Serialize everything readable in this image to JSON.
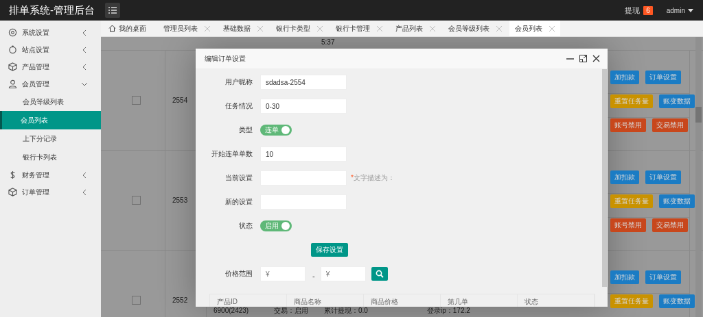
{
  "header": {
    "title": "排单系统-管理后台",
    "withdraw_label": "提现",
    "withdraw_count": "6",
    "user": "admin"
  },
  "sidebar": {
    "items": [
      {
        "label": "系统设置",
        "expanded": false
      },
      {
        "label": "站点设置",
        "expanded": false
      },
      {
        "label": "产品管理",
        "expanded": false
      },
      {
        "label": "会员管理",
        "expanded": true,
        "children": [
          {
            "label": "会员等级列表",
            "selected": false
          },
          {
            "label": "会员列表",
            "selected": true
          },
          {
            "label": "上下分记录",
            "selected": false
          },
          {
            "label": "银行卡列表",
            "selected": false
          }
        ]
      },
      {
        "label": "财务管理",
        "expanded": false
      },
      {
        "label": "订单管理",
        "expanded": false
      }
    ]
  },
  "tabs": [
    {
      "kind": "home",
      "label": "我的桌面",
      "selected": false
    },
    {
      "kind": "page",
      "label": "管理员列表",
      "selected": false
    },
    {
      "kind": "page",
      "label": "基础数据",
      "selected": false
    },
    {
      "kind": "page",
      "label": "银行卡类型",
      "selected": false
    },
    {
      "kind": "page",
      "label": "银行卡管理",
      "selected": false
    },
    {
      "kind": "page",
      "label": "产品列表",
      "selected": false
    },
    {
      "kind": "page",
      "label": "会员等级列表",
      "selected": false
    },
    {
      "kind": "page",
      "label": "会员列表",
      "selected": true
    }
  ],
  "table": {
    "top_row": {
      "column_6": "5:37"
    },
    "rows": [
      {
        "id": "2554",
        "checked": false,
        "actions": [
          [
            {
              "label": "加扣款",
              "color": "#1b7cc4"
            },
            {
              "label": "订单设置",
              "color": "#1b7cc4"
            }
          ],
          [
            {
              "label": "重置任务量",
              "color": "#c99200"
            },
            {
              "label": "账变数据",
              "color": "#1b7cc4"
            }
          ],
          [
            {
              "label": "账号禁用",
              "color": "#c8471c"
            },
            {
              "label": "交易禁用",
              "color": "#c8471c"
            }
          ]
        ]
      },
      {
        "id": "2553",
        "checked": false,
        "actions": [
          [
            {
              "label": "加扣款",
              "color": "#1b7cc4"
            },
            {
              "label": "订单设置",
              "color": "#1b7cc4"
            }
          ],
          [
            {
              "label": "重置任务量",
              "color": "#c99200"
            },
            {
              "label": "账变数据",
              "color": "#1b7cc4"
            }
          ],
          [
            {
              "label": "账号禁用",
              "color": "#c8471c"
            },
            {
              "label": "交易禁用",
              "color": "#c8471c"
            }
          ]
        ]
      },
      {
        "id": "2552",
        "checked": false,
        "cells": {
          "column_4": "6900(2423)",
          "column_5": "交易：启用",
          "column_6": "累计提现：0.0",
          "column_8": "登录ip：172.2"
        },
        "actions": [
          [
            {
              "label": "加扣款",
              "color": "#1b7cc4"
            },
            {
              "label": "订单设置",
              "color": "#1b7cc4"
            }
          ],
          [
            {
              "label": "重置任务量",
              "color": "#c99200"
            },
            {
              "label": "账变数据",
              "color": "#1b7cc4"
            }
          ]
        ]
      }
    ]
  },
  "modal": {
    "title": "编辑订单设置",
    "fields": [
      {
        "kind": "text",
        "label": "用户昵称",
        "value": "sdadsa-2554"
      },
      {
        "kind": "text",
        "label": "任务情况",
        "value": "0-30"
      },
      {
        "kind": "switch",
        "label": "类型",
        "text": "连单",
        "on": true
      },
      {
        "kind": "text",
        "label": "开始连单单数",
        "value": "10"
      },
      {
        "kind": "text",
        "label": "当前设置",
        "required_mark": "*",
        "hint": "文字描述为："
      },
      {
        "kind": "text",
        "label": "新的设置"
      },
      {
        "kind": "switch",
        "label": "状态",
        "text": "启用",
        "on": true
      },
      {
        "kind": "button",
        "text": "保存设置"
      },
      {
        "kind": "range",
        "label": "价格范围",
        "from_placeholder": "¥",
        "separator": "-",
        "to_placeholder": "¥"
      }
    ],
    "table_columns": [
      "产品ID",
      "商品名称",
      "商品价格",
      "第几单",
      "状态"
    ]
  }
}
